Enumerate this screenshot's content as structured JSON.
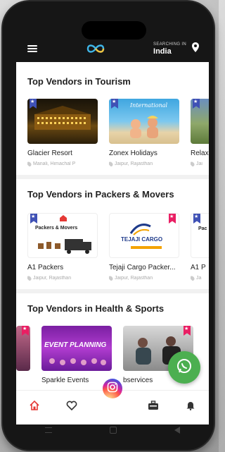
{
  "header": {
    "location_caption": "SEARCHING IN",
    "location": "India"
  },
  "sections": [
    {
      "title": "Top Vendors in Tourism",
      "cards": [
        {
          "name": "Glacier Resort",
          "place": "Manali, Himachal P"
        },
        {
          "name": "Zonex Holidays",
          "place": "Jaipur, Rajasthan"
        },
        {
          "name": "Relax",
          "place": "Jai"
        }
      ]
    },
    {
      "title": "Top Vendors in Packers & Movers",
      "cards": [
        {
          "name": "A1 Packers",
          "place": "Jaipur, Rajasthan",
          "thumb_text": "Packers & Movers"
        },
        {
          "name": "Tejaji Cargo Packer...",
          "place": "Jaipur, Rajasthan",
          "thumb_text": "TEJAJI CARGO"
        },
        {
          "name": "A1 P",
          "place": "Ja",
          "thumb_text": "Pac"
        }
      ]
    },
    {
      "title": "Top Vendors in Health & Sports",
      "cards": [
        {
          "name": "",
          "place": ""
        },
        {
          "name": "Sparkle Events",
          "place": "",
          "thumb_text": "EVENT PLANNING"
        },
        {
          "name": "bservices",
          "place": ""
        }
      ]
    }
  ],
  "colors": {
    "ribbon_blue": "#3f51b5",
    "ribbon_pink": "#e91e63",
    "whatsapp": "#4caf50",
    "active_nav": "#e53935"
  }
}
